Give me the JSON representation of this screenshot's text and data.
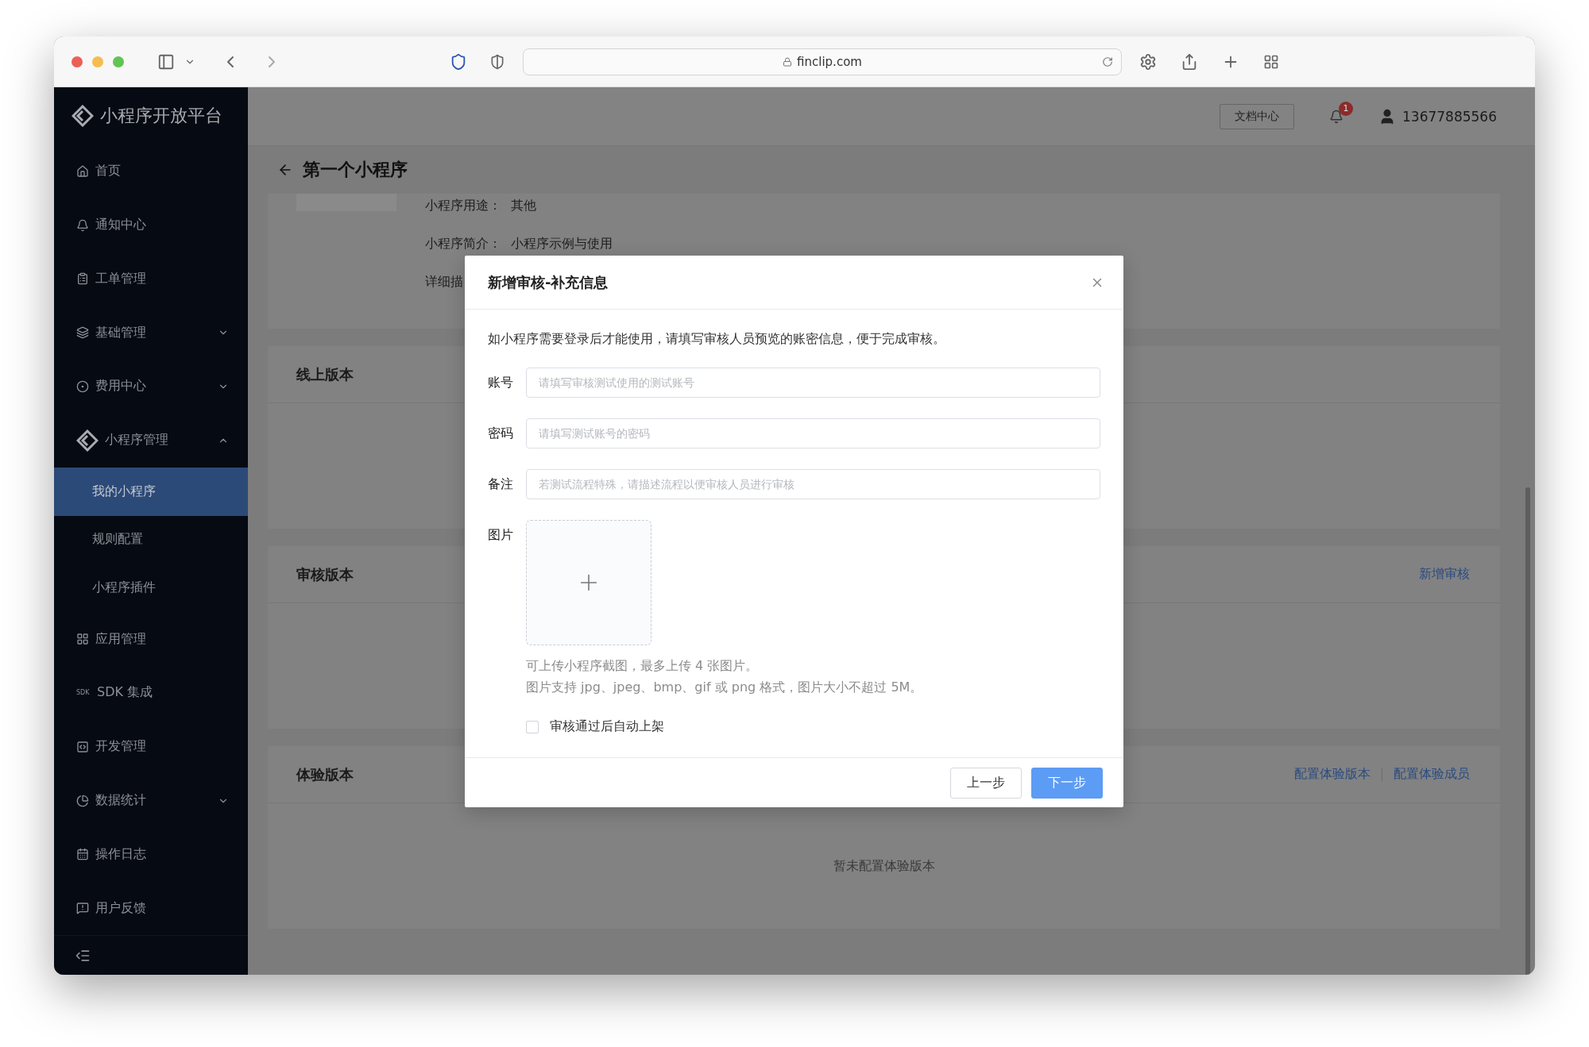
{
  "browser": {
    "url": "finclip.com"
  },
  "sidebar": {
    "logo": "小程序开放平台",
    "items": [
      {
        "label": "首页",
        "kind": "item"
      },
      {
        "label": "通知中心",
        "kind": "item"
      },
      {
        "label": "工单管理",
        "kind": "item"
      },
      {
        "label": "基础管理",
        "kind": "group",
        "expanded": false
      },
      {
        "label": "费用中心",
        "kind": "group",
        "expanded": false
      },
      {
        "label": "小程序管理",
        "kind": "group",
        "expanded": true,
        "children": [
          {
            "label": "我的小程序",
            "selected": true
          },
          {
            "label": "规则配置",
            "selected": false
          },
          {
            "label": "小程序插件",
            "selected": false
          }
        ]
      },
      {
        "label": "应用管理",
        "kind": "item"
      },
      {
        "label": "SDK 集成",
        "kind": "item",
        "icon_text": "SDK"
      },
      {
        "label": "开发管理",
        "kind": "item"
      },
      {
        "label": "数据统计",
        "kind": "group",
        "expanded": false
      },
      {
        "label": "操作日志",
        "kind": "item"
      },
      {
        "label": "用户反馈",
        "kind": "item"
      }
    ]
  },
  "header": {
    "docs_button": "文档中心",
    "notification_count": "1",
    "user": "13677885566"
  },
  "page": {
    "title": "第一个小程序",
    "info_rows": [
      {
        "label": "小程序用途：",
        "value": "其他"
      },
      {
        "label": "小程序简介：",
        "value": "小程序示例与使用"
      },
      {
        "label": "详细描"
      }
    ],
    "sections": [
      {
        "title": "线上版本"
      },
      {
        "title": "审核版本",
        "actions": [
          "新增审核"
        ]
      },
      {
        "title": "体验版本",
        "actions": [
          "配置体验版本",
          "配置体验成员"
        ],
        "empty_text": "暂未配置体验版本"
      }
    ]
  },
  "dialog": {
    "title": "新增审核-补充信息",
    "intro": "如小程序需要登录后才能使用，请填写审核人员预览的账密信息，便于完成审核。",
    "fields": [
      {
        "label": "账号",
        "placeholder": "请填写审核测试使用的测试账号"
      },
      {
        "label": "密码",
        "placeholder": "请填写测试账号的密码"
      },
      {
        "label": "备注",
        "placeholder": "若测试流程特殊，请描述流程以便审核人员进行审核"
      }
    ],
    "upload": {
      "label": "图片",
      "hints": [
        "可上传小程序截图，最多上传 4 张图片。",
        "图片支持 jpg、jpeg、bmp、gif 或 png 格式，图片大小不超过 5M。"
      ]
    },
    "auto_publish": {
      "label": "审核通过后自动上架",
      "checked": false
    },
    "buttons": [
      {
        "label": "上一步",
        "kind": "secondary"
      },
      {
        "label": "下一步",
        "kind": "primary"
      }
    ]
  }
}
